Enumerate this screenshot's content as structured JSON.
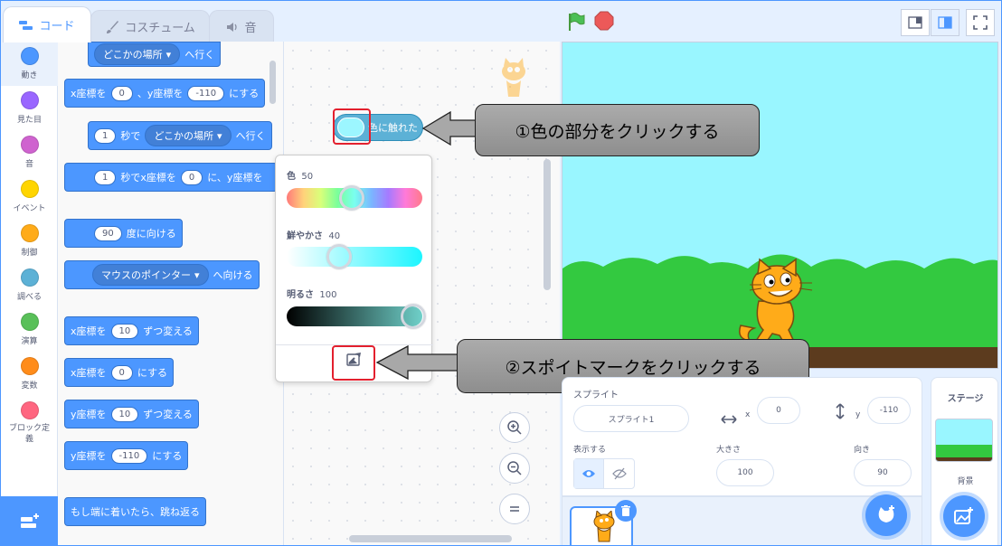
{
  "tabs": {
    "code": "コード",
    "costume": "コスチューム",
    "sound": "音"
  },
  "categories": [
    {
      "label": "動き",
      "color": "#4c97ff"
    },
    {
      "label": "見た目",
      "color": "#9966ff"
    },
    {
      "label": "音",
      "color": "#cf63cf"
    },
    {
      "label": "イベント",
      "color": "#ffd500"
    },
    {
      "label": "制御",
      "color": "#ffab19"
    },
    {
      "label": "調べる",
      "color": "#5cb1d6"
    },
    {
      "label": "演算",
      "color": "#59c059"
    },
    {
      "label": "変数",
      "color": "#ff8c1a"
    },
    {
      "label": "ブロック定義",
      "color": "#ff6680"
    }
  ],
  "blocks": {
    "goto_dd": "どこかの場所",
    "goto_suffix": "へ行く",
    "gotoxy_x_prefix": "x座標を",
    "gotoxy_x": "0",
    "gotoxy_y_prefix": "、y座標を",
    "gotoxy_y": "-110",
    "gotoxy_suffix": "にする",
    "glide_secs": "1",
    "glide_secs_label": "秒で",
    "glide_dd": "どこかの場所",
    "glide_suffix": "へ行く",
    "glidexy_secs": "1",
    "glidexy_label": "秒でx座標を",
    "glidexy_x": "0",
    "glidexy_mid": "に、y座標を",
    "point_deg": "90",
    "point_suffix": "度に向ける",
    "pointto_dd": "マウスのポインター",
    "pointto_suffix": "へ向ける",
    "changex_prefix": "x座標を",
    "changex_val": "10",
    "changex_suffix": "ずつ変える",
    "setx_prefix": "x座標を",
    "setx_val": "0",
    "setx_suffix": "にする",
    "changey_prefix": "y座標を",
    "changey_val": "10",
    "changey_suffix": "ずつ変える",
    "sety_prefix": "y座標を",
    "sety_val": "-110",
    "sety_suffix": "にする",
    "bounce": "もし端に着いたら、跳ね返る"
  },
  "sensing_block": {
    "label": "色に触れた",
    "swatch_color": "#9cf6ff"
  },
  "color_picker": {
    "color_label": "色",
    "color_value": "50",
    "saturation_label": "鮮やかさ",
    "saturation_value": "40",
    "brightness_label": "明るさ",
    "brightness_value": "100",
    "hue_fraction": 0.5,
    "saturation_fraction": 0.4,
    "brightness_fraction": 1.0
  },
  "callouts": {
    "one": "①色の部分をクリックする",
    "two": "②スポイトマークをクリックする"
  },
  "sprite_info": {
    "sprite_label": "スプライト",
    "name": "スプライト1",
    "x_label": "x",
    "x_value": "0",
    "y_label": "y",
    "y_value": "-110",
    "show_label": "表示する",
    "size_label": "大きさ",
    "size_value": "100",
    "direction_label": "向き",
    "direction_value": "90"
  },
  "stage_panel": {
    "title": "ステージ",
    "backdrop_label": "背景"
  },
  "colors": {
    "accent": "#4d97ff",
    "motion": "#4c97ff",
    "sensing": "#5cb1d6",
    "stage_sky": "#99f6ff",
    "grass": "#33c940"
  }
}
